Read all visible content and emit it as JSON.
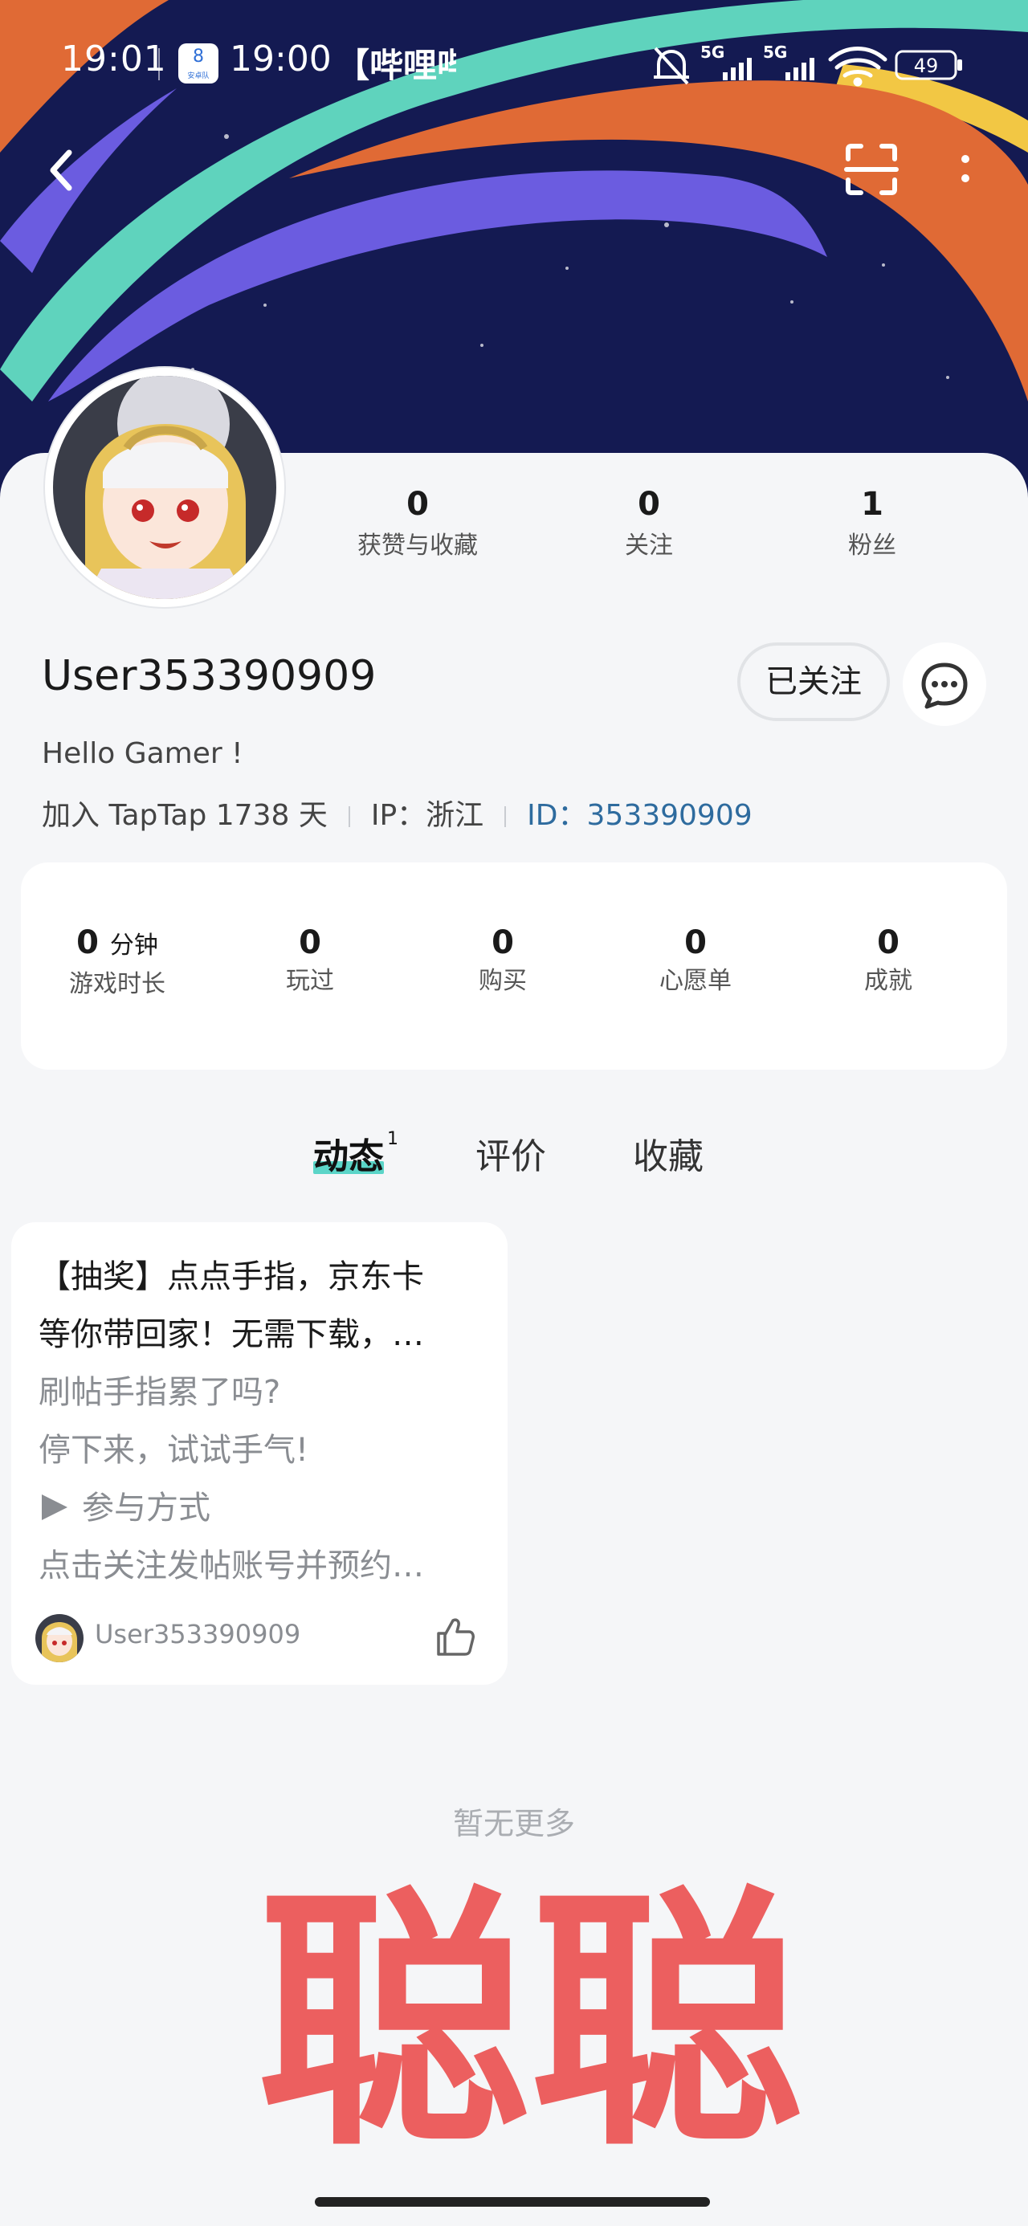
{
  "status_bar": {
    "time": "19:01",
    "app_badge": "8",
    "app_badge_sub": "安卓队",
    "time2": "19:00",
    "notification": "【哔哩哔",
    "network1": "5G",
    "network2": "5G",
    "battery": "49"
  },
  "colors": {
    "banner_bg": "#141a52",
    "stripe_orange": "#e06a35",
    "stripe_teal": "#5fd3bd",
    "stripe_purple": "#6b5ce0",
    "accent_teal": "#3fcfc0",
    "id_link": "#2e6b9e",
    "watermark": "#ec5f5f"
  },
  "icons": {
    "back": "chevron-left-icon",
    "scan": "scan-icon",
    "more": "more-vertical-icon",
    "message": "message-bubble-icon",
    "like": "thumbs-up-icon",
    "play": "play-triangle-icon"
  },
  "profile": {
    "stats": [
      {
        "value": "0",
        "label": "获赞与收藏"
      },
      {
        "value": "0",
        "label": "关注"
      },
      {
        "value": "1",
        "label": "粉丝"
      }
    ],
    "username": "User353390909",
    "follow_label": "已关注",
    "bio": "Hello Gamer !",
    "joined": "加入 TapTap 1738 天",
    "ip": "IP：浙江",
    "id_label": "ID：353390909"
  },
  "game_stats": [
    {
      "value": "0",
      "unit": "分钟",
      "label": "游戏时长"
    },
    {
      "value": "0",
      "unit": "",
      "label": "玩过"
    },
    {
      "value": "0",
      "unit": "",
      "label": "购买"
    },
    {
      "value": "0",
      "unit": "",
      "label": "心愿单"
    },
    {
      "value": "0",
      "unit": "",
      "label": "成就"
    }
  ],
  "tabs": [
    {
      "label": "动态",
      "badge": "1",
      "active": true
    },
    {
      "label": "评价",
      "badge": "",
      "active": false
    },
    {
      "label": "收藏",
      "badge": "",
      "active": false
    }
  ],
  "post": {
    "title_line1": "【抽奖】点点手指，京东卡",
    "title_line2": "等你带回家！无需下载，…",
    "body": [
      "刷帖手指累了吗?",
      "停下来，试试手气!",
      "参与方式",
      "点击关注发帖账号并预约…"
    ],
    "author": "User353390909"
  },
  "no_more": "暂无更多",
  "watermark": "聪聪"
}
